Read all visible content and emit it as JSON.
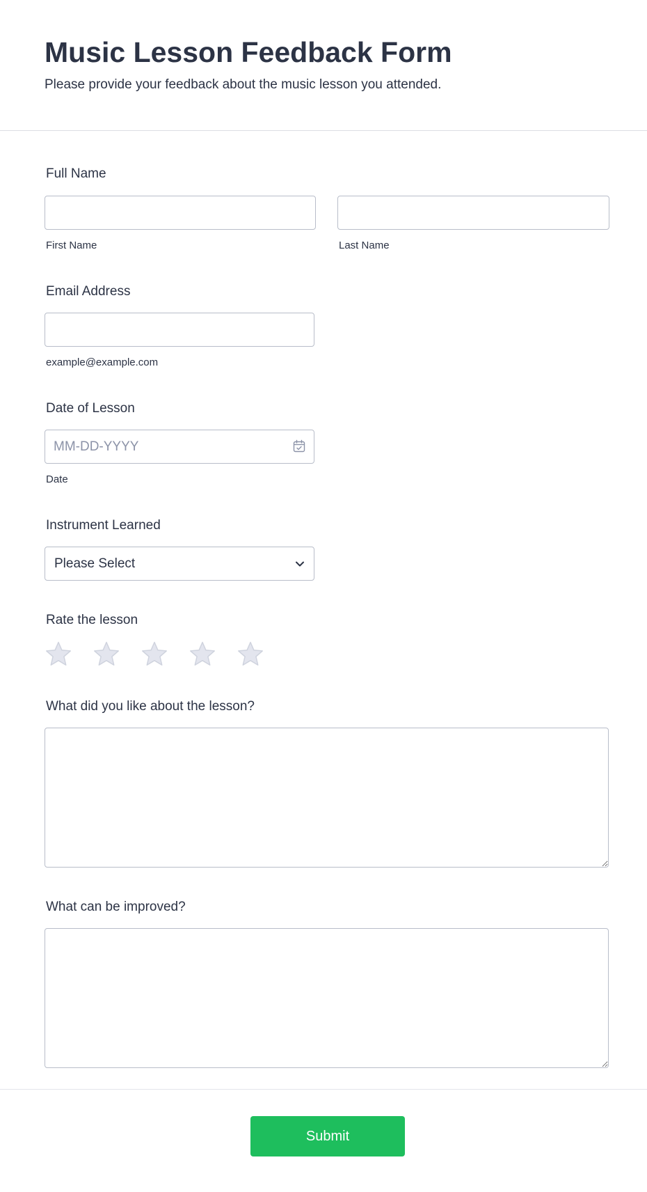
{
  "header": {
    "title": "Music Lesson Feedback Form",
    "subtitle": "Please provide your feedback about the music lesson you attended."
  },
  "full_name": {
    "label": "Full Name",
    "first_sublabel": "First Name",
    "last_sublabel": "Last Name",
    "first_value": "",
    "last_value": ""
  },
  "email": {
    "label": "Email Address",
    "value": "",
    "sublabel": "example@example.com"
  },
  "lesson_date": {
    "label": "Date of Lesson",
    "placeholder": "MM-DD-YYYY",
    "value": "",
    "sublabel": "Date",
    "icon": "calendar-icon"
  },
  "instrument": {
    "label": "Instrument Learned",
    "selected": "Please Select",
    "icon": "chevron-down-icon"
  },
  "rating": {
    "label": "Rate the lesson",
    "max": 5,
    "value": 0,
    "icon": "star-icon",
    "empty_color": "#e3e5ee",
    "empty_stroke": "#cfd3de"
  },
  "liked": {
    "label": "What did you like about the lesson?",
    "value": ""
  },
  "improved": {
    "label": "What can be improved?",
    "value": ""
  },
  "submit": {
    "label": "Submit",
    "color": "#1ebe5d"
  },
  "colors": {
    "text": "#2c3345",
    "border": "#b8bdc9",
    "placeholder": "#8c93a8"
  }
}
